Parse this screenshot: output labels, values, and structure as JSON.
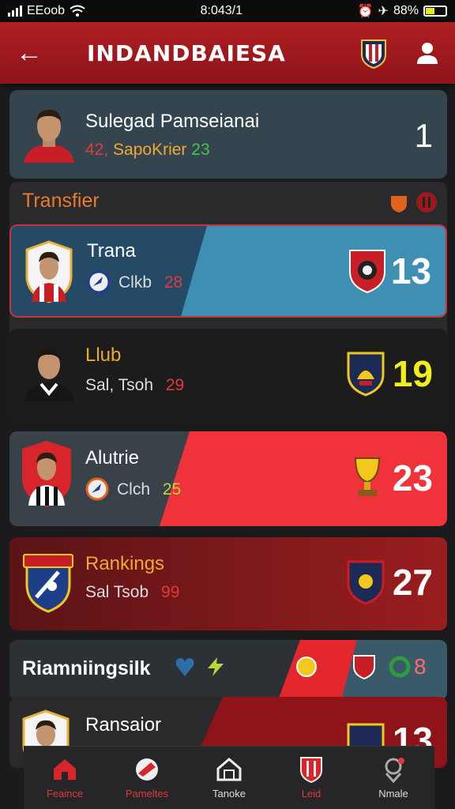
{
  "status": {
    "carrier": "EEoob",
    "time": "8:043/1",
    "battery": "88%"
  },
  "header": {
    "title": "INDANDBAIESA"
  },
  "top_card": {
    "name": "Sulegad Pamseianai",
    "score_a": "42,",
    "label": "SapoKrier",
    "score_b": "23",
    "rank": "1"
  },
  "section1": {
    "title": "Transfier"
  },
  "players": [
    {
      "name": "Trana",
      "club": "Clkb",
      "value": "28",
      "rank": "13",
      "rank_color": "#ffffff",
      "name_color": "#ffffff",
      "value_color": "#e0393c"
    },
    {
      "name": "Llub",
      "club": "Sal, Tsoh",
      "value": "29",
      "rank": "19",
      "rank_color": "#f2ee1c",
      "name_color": "#f0a830",
      "value_color": "#e0393c"
    },
    {
      "name": "Alutrie",
      "club": "Clch",
      "value": "25",
      "rank": "23",
      "rank_color": "#ffffff",
      "name_color": "#ffffff",
      "value_color": "#b9d83a"
    },
    {
      "name": "Rankings",
      "club": "Sal Tsob",
      "value": "99",
      "rank": "27",
      "rank_color": "#ffffff",
      "name_color": "#f0a830",
      "value_color": "#e0393c"
    }
  ],
  "section2": {
    "title": "Riamniingsilk",
    "count": "8"
  },
  "last_card": {
    "name": "Ransaior",
    "rank": "13"
  },
  "nav": [
    {
      "label": "Feaince",
      "icon": "home-icon"
    },
    {
      "label": "Pameltes",
      "icon": "whistle-icon"
    },
    {
      "label": "Tanoke",
      "icon": "stadium-icon"
    },
    {
      "label": "Leid",
      "icon": "shield-icon"
    },
    {
      "label": "Nmale",
      "icon": "location-icon"
    }
  ],
  "colors": {
    "brand": "#b01e22",
    "accent": "#e87a2e"
  }
}
